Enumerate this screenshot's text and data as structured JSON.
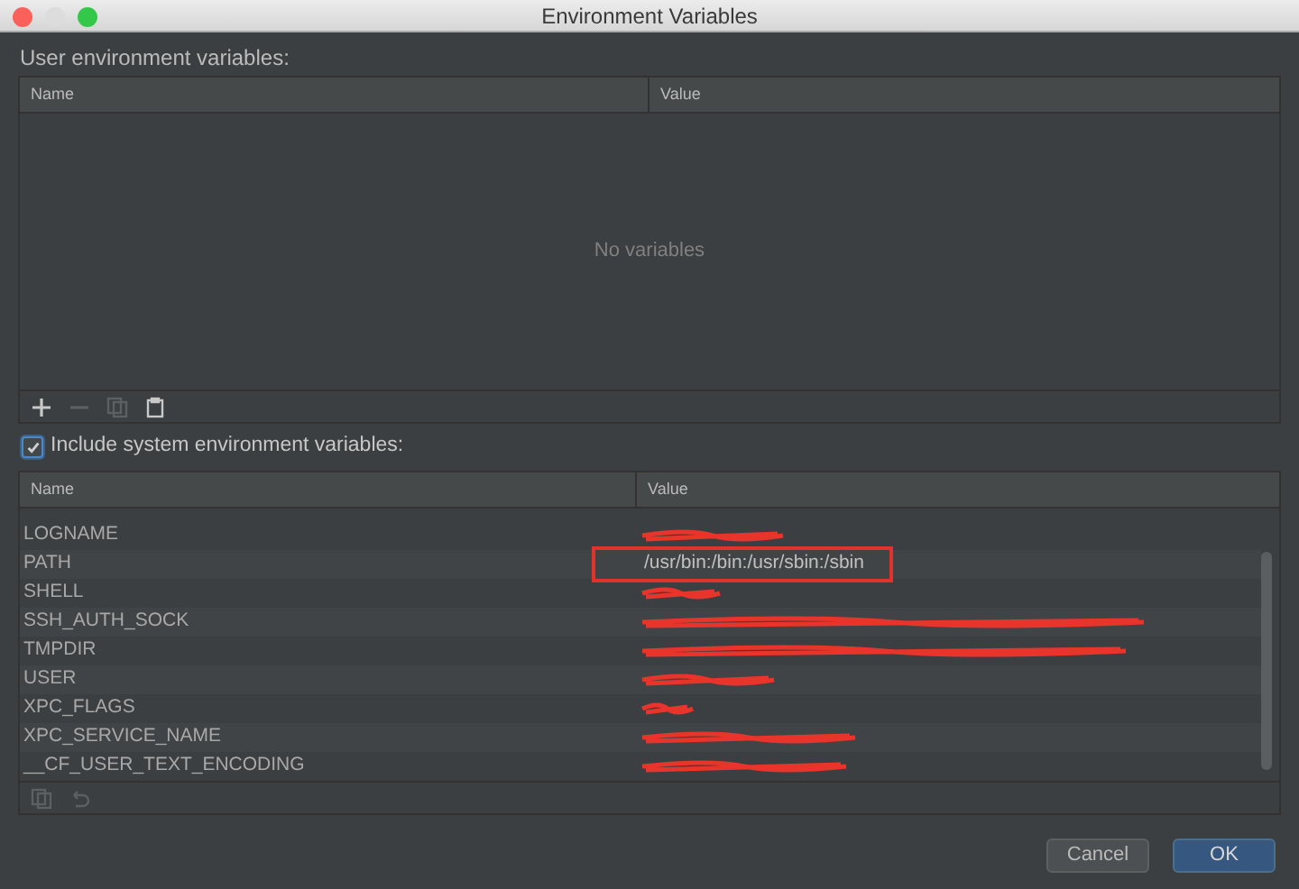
{
  "window": {
    "title": "Environment Variables"
  },
  "user_section": {
    "label": "User environment variables:",
    "columns": [
      "Name",
      "Value"
    ],
    "empty_text": "No variables",
    "toolbar": [
      {
        "kind": "add",
        "disabled": false
      },
      {
        "kind": "remove",
        "disabled": true
      },
      {
        "kind": "copy",
        "disabled": true
      },
      {
        "kind": "paste",
        "disabled": false
      }
    ]
  },
  "include_system": {
    "label": "Include system environment variables:",
    "checked": true
  },
  "system_section": {
    "columns": [
      "Name",
      "Value"
    ],
    "rows": [
      {
        "name": "LOGNAME",
        "redacted": true,
        "highlighted": false
      },
      {
        "name": "PATH",
        "value": "/usr/bin:/bin:/usr/sbin:/sbin",
        "redacted": false,
        "highlighted": true
      },
      {
        "name": "SHELL",
        "redacted": true,
        "highlighted": false
      },
      {
        "name": "SSH_AUTH_SOCK",
        "redacted": true,
        "highlighted": false
      },
      {
        "name": "TMPDIR",
        "redacted": true,
        "highlighted": false
      },
      {
        "name": "USER",
        "redacted": true,
        "highlighted": false
      },
      {
        "name": "XPC_FLAGS",
        "redacted": true,
        "highlighted": false
      },
      {
        "name": "XPC_SERVICE_NAME",
        "redacted": true,
        "highlighted": false
      },
      {
        "name": "__CF_USER_TEXT_ENCODING",
        "redacted": true,
        "highlighted": false
      }
    ],
    "toolbar": [
      {
        "kind": "copy",
        "disabled": true
      },
      {
        "kind": "undo",
        "disabled": true
      }
    ]
  },
  "buttons": [
    {
      "label": "Cancel",
      "kind": "secondary"
    },
    {
      "label": "OK",
      "kind": "primary"
    }
  ]
}
